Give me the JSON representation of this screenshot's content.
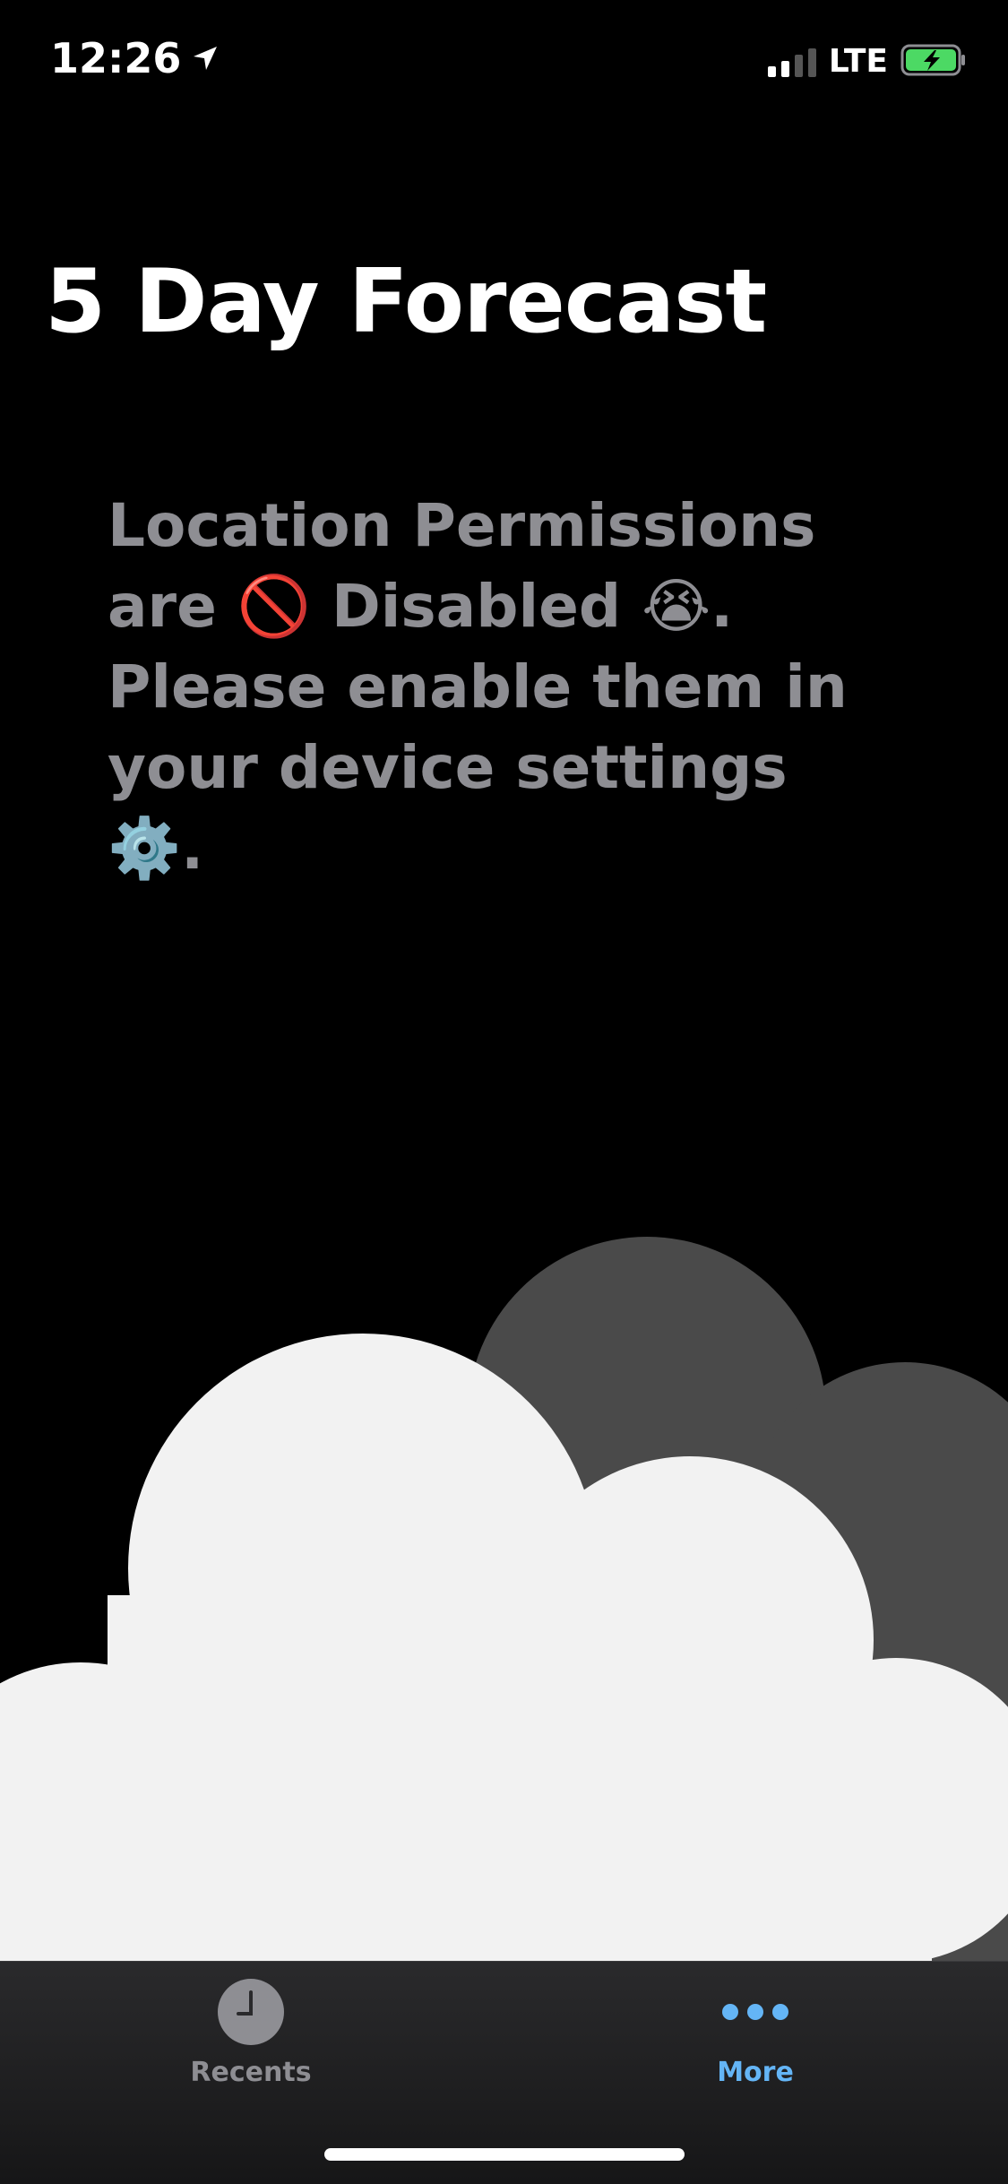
{
  "status_bar": {
    "time": "12:26",
    "network": "LTE",
    "signal_bars_active": 2,
    "signal_bars_total": 4,
    "battery_charging": true,
    "battery_color": "#4cd964"
  },
  "header": {
    "title": "5 Day Forecast"
  },
  "main": {
    "message": "Location Permissions are 🚫 Disabled 😭. Please enable them in your device settings ⚙️."
  },
  "tab_bar": {
    "tabs": [
      {
        "label": "Recents",
        "icon": "clock-icon",
        "active": false
      },
      {
        "label": "More",
        "icon": "more-dots-icon",
        "active": true
      }
    ],
    "active_color": "#64b5f6",
    "inactive_color": "#8e8e93"
  },
  "colors": {
    "background": "#000000",
    "message_text": "#8e8e93",
    "cloud_front": "#f2f2f2",
    "cloud_back": "#4a4a4a"
  }
}
